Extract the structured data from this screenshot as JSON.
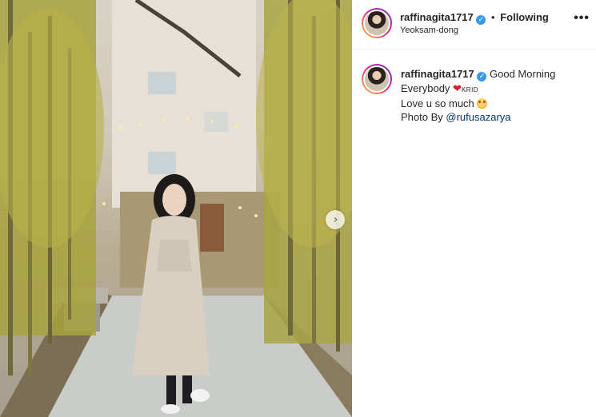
{
  "post": {
    "username": "raffinagita1717",
    "verified_icon": "verified-badge-icon",
    "separator": "•",
    "follow_status": "Following",
    "location": "Yeoksam-dong",
    "more_icon": "•••"
  },
  "caption": {
    "username": "raffinagita1717",
    "line1": "Good Morning",
    "line2": "Everybody",
    "heart_icon": "❤",
    "tag": "KRID",
    "line3": "Love u so much",
    "emoji_icon": "smiling-face-with-hearts-icon",
    "photo_by": "Photo By",
    "mention": "@rufusazarya"
  },
  "photo": {
    "carousel_arrow": "›"
  }
}
